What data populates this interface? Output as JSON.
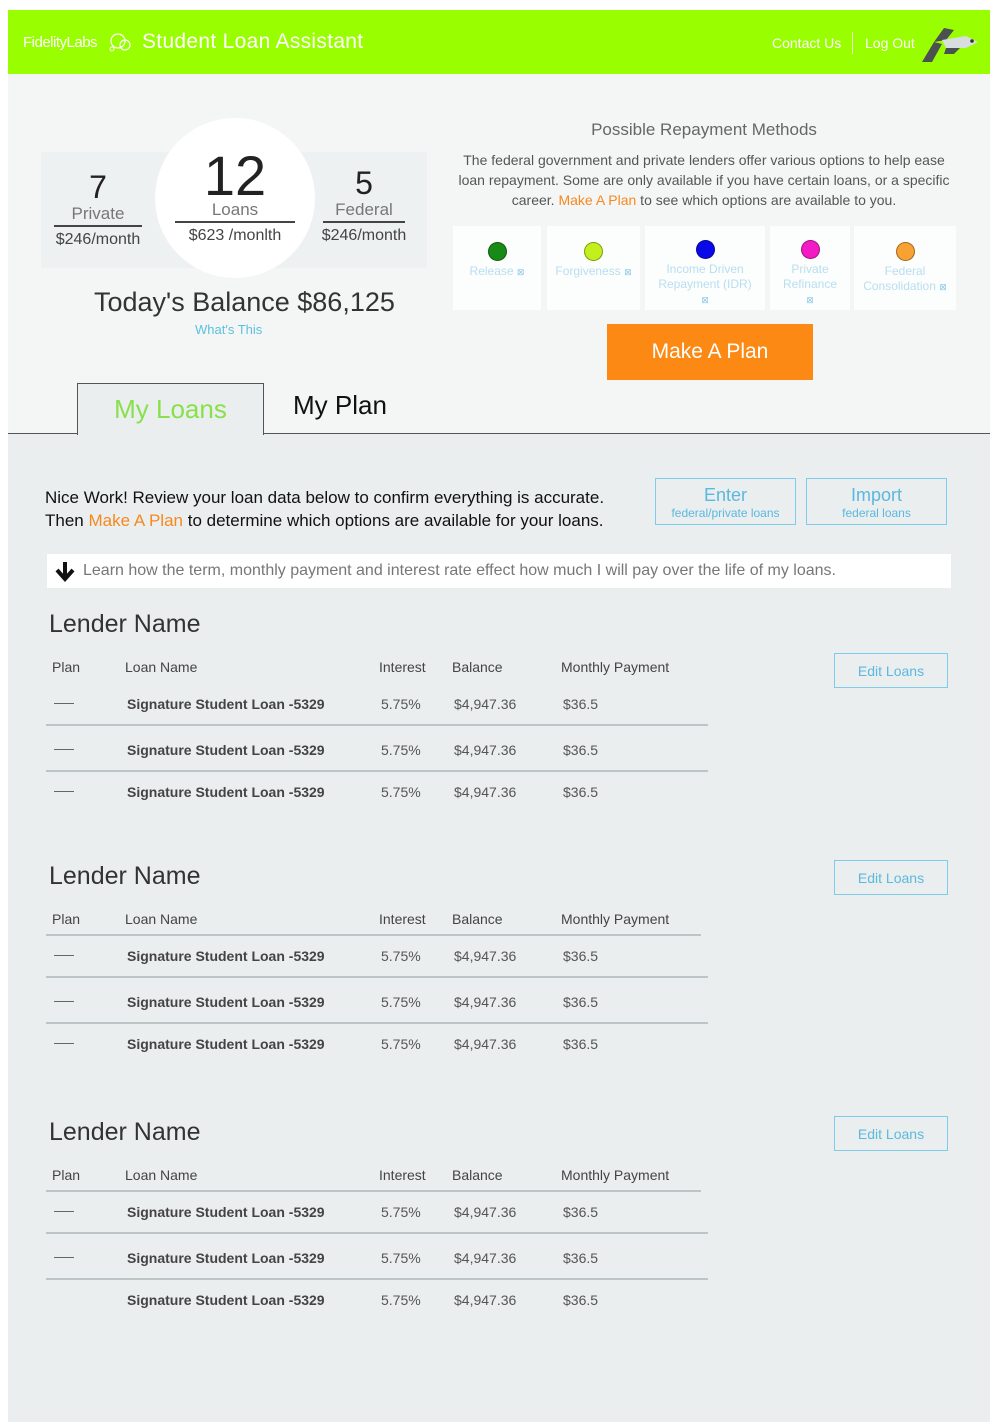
{
  "header": {
    "brand": "FidelityLabs",
    "app_title": "Student Loan Assistant",
    "contact_label": "Contact Us",
    "logout_label": "Log Out",
    "brand_color": "#99ff00"
  },
  "summary": {
    "private": {
      "count": "7",
      "label": "Private",
      "amount": "$246/month"
    },
    "total": {
      "count": "12",
      "label": "Loans",
      "amount": "$623 /monlth"
    },
    "federal": {
      "count": "5",
      "label": "Federal",
      "amount": "$246/month"
    },
    "balance_text": "Today's Balance $86,125",
    "whats_this": "What's This"
  },
  "methods": {
    "title": "Possible Repayment Methods",
    "desc_pre": "The federal government and private lenders offer various options to help ease loan repayment.  Some are only available if you have certain loans, or a specific career.  ",
    "desc_link": "Make A Plan",
    "desc_post": " to see which options are available to you.",
    "items": [
      {
        "label": "Release",
        "color": "#178a17",
        "info": "⊠"
      },
      {
        "label": "Forgiveness",
        "color": "#c3ef1c",
        "info": "⊠"
      },
      {
        "label": "Income Driven Repayment (IDR)",
        "color": "#0a0ae8",
        "info": "⊠"
      },
      {
        "label": "Private Refinance",
        "color": "#f21bc4",
        "info": "⊠"
      },
      {
        "label": "Federal Consolidation",
        "color": "#f7a233",
        "info": "⊠"
      }
    ],
    "make_plan_label": "Make A Plan",
    "accent": "#fb8913"
  },
  "tabs": [
    {
      "label": "My Loans",
      "active": true
    },
    {
      "label": "My Plan",
      "active": false
    }
  ],
  "intro": {
    "line1": "Nice Work! Review your loan data below to confirm everything is accurate.",
    "line2_pre": "Then ",
    "line2_link": "Make A Plan",
    "line2_post": " to determine which options are available for your loans."
  },
  "actions": {
    "enter": {
      "title": "Enter",
      "subtitle": "federal/private loans"
    },
    "import": {
      "title": "Import",
      "subtitle": "federal loans"
    }
  },
  "learn_text": "Learn how the term, monthly payment and interest rate effect how much I will pay over the life of my loans.",
  "columns": [
    "Plan",
    "Loan Name",
    "Interest",
    "Balance",
    "Monthly Payment"
  ],
  "edit_label": "Edit Loans",
  "lenders": [
    {
      "name": "Lender Name",
      "loans": [
        {
          "plan": "—",
          "name": "Signature Student Loan -5329",
          "interest": "5.75%",
          "balance": "$4,947.36",
          "monthly": "$36.5"
        },
        {
          "plan": "—",
          "name": "Signature Student Loan -5329",
          "interest": "5.75%",
          "balance": "$4,947.36",
          "monthly": "$36.5"
        },
        {
          "plan": "—",
          "name": "Signature Student Loan -5329",
          "interest": "5.75%",
          "balance": "$4,947.36",
          "monthly": "$36.5"
        }
      ]
    },
    {
      "name": "Lender Name",
      "loans": [
        {
          "plan": "—",
          "name": "Signature Student Loan -5329",
          "interest": "5.75%",
          "balance": "$4,947.36",
          "monthly": "$36.5"
        },
        {
          "plan": "—",
          "name": "Signature Student Loan -5329",
          "interest": "5.75%",
          "balance": "$4,947.36",
          "monthly": "$36.5"
        },
        {
          "plan": "—",
          "name": "Signature Student Loan -5329",
          "interest": "5.75%",
          "balance": "$4,947.36",
          "monthly": "$36.5"
        }
      ]
    },
    {
      "name": "Lender Name",
      "loans": [
        {
          "plan": "—",
          "name": "Signature Student Loan -5329",
          "interest": "5.75%",
          "balance": "$4,947.36",
          "monthly": "$36.5"
        },
        {
          "plan": "—",
          "name": "Signature Student Loan -5329",
          "interest": "5.75%",
          "balance": "$4,947.36",
          "monthly": "$36.5"
        },
        {
          "plan": "",
          "name": "Signature Student Loan -5329",
          "interest": "5.75%",
          "balance": "$4,947.36",
          "monthly": "$36.5"
        }
      ]
    }
  ]
}
